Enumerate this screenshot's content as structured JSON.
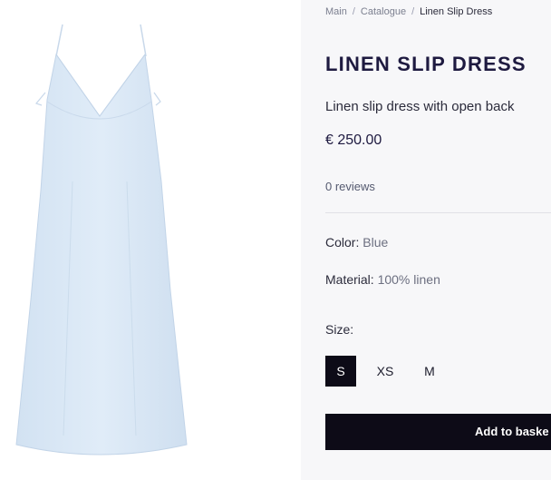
{
  "breadcrumb": {
    "items": [
      "Main",
      "Catalogue"
    ],
    "separator": "/",
    "current": "Linen Slip Dress"
  },
  "product": {
    "title": "LINEN SLIP DRESS",
    "subtitle": "Linen slip dress with open back",
    "price": "€ 250.00",
    "reviews": "0 reviews",
    "color_label": "Color:",
    "color_value": "Blue",
    "material_label": "Material:",
    "material_value": "100% linen",
    "size_label": "Size:",
    "sizes": [
      "S",
      "XS",
      "M"
    ],
    "selected_size": "S",
    "add_to_basket": "Add to baske"
  },
  "colors": {
    "dress": "#dce9f6",
    "button": "#0d0b17",
    "panel": "#f7f7f9"
  }
}
